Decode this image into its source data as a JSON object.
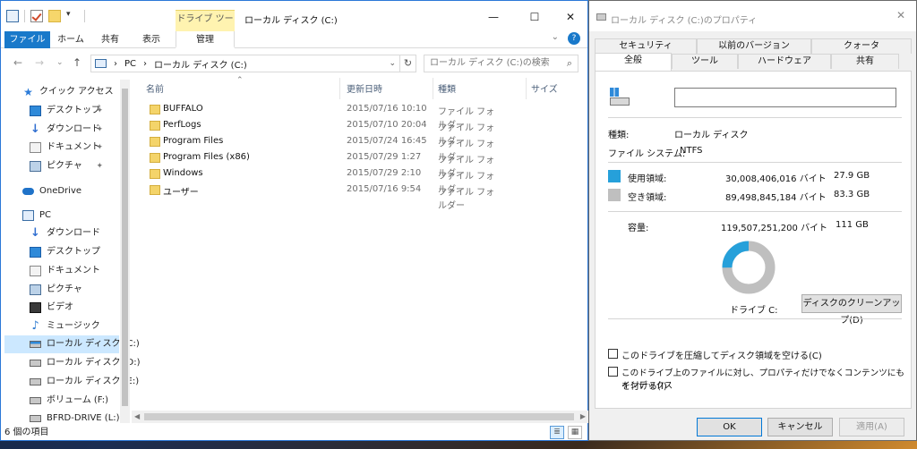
{
  "explorer": {
    "title": "ローカル ディスク (C:)",
    "contextual_tab_group": "ドライブ ツール",
    "ribbon_tabs": [
      "ファイル",
      "ホーム",
      "共有",
      "表示",
      "管理"
    ],
    "window_buttons": {
      "minimize": "—",
      "maximize": "☐",
      "close": "✕"
    },
    "address": {
      "segments": [
        "PC",
        "ローカル ディスク (C:)"
      ],
      "separator": "›"
    },
    "search_placeholder": "ローカル ディスク (C:)の検索",
    "columns": [
      "名前",
      "更新日時",
      "種類",
      "サイズ"
    ],
    "files": [
      {
        "name": "BUFFALO",
        "date": "2015/07/16 10:10",
        "type": "ファイル フォルダー"
      },
      {
        "name": "PerfLogs",
        "date": "2015/07/10 20:04",
        "type": "ファイル フォルダー"
      },
      {
        "name": "Program Files",
        "date": "2015/07/24 16:45",
        "type": "ファイル フォルダー"
      },
      {
        "name": "Program Files (x86)",
        "date": "2015/07/29 1:27",
        "type": "ファイル フォルダー"
      },
      {
        "name": "Windows",
        "date": "2015/07/29 2:10",
        "type": "ファイル フォルダー"
      },
      {
        "name": "ユーザー",
        "date": "2015/07/16 9:54",
        "type": "ファイル フォルダー"
      }
    ],
    "nav": {
      "quick_access": "クイック アクセス",
      "quick_items": [
        "デスクトップ",
        "ダウンロード",
        "ドキュメント",
        "ピクチャ"
      ],
      "onedrive": "OneDrive",
      "pc": "PC",
      "pc_items": [
        "ダウンロード",
        "デスクトップ",
        "ドキュメント",
        "ピクチャ",
        "ビデオ",
        "ミュージック",
        "ローカル ディスク (C:)",
        "ローカル ディスク (D:)",
        "ローカル ディスク (E:)",
        "ボリューム (F:)",
        "BFRD-DRIVE (L:)"
      ],
      "selected": "ローカル ディスク (C:)"
    },
    "status": "6 個の項目"
  },
  "props": {
    "title": "ローカル ディスク (C:)のプロパティ",
    "close": "✕",
    "tabs_row1": [
      "セキュリティ",
      "以前のバージョン",
      "クォータ"
    ],
    "tabs_row2": [
      "全般",
      "ツール",
      "ハードウェア",
      "共有"
    ],
    "active_tab": "全般",
    "volume_name_value": "",
    "type_label": "種類:",
    "type_value": "ローカル ディスク",
    "fs_label": "ファイル システム:",
    "fs_value": "NTFS",
    "used_label": "使用領域:",
    "used_bytes": "30,008,406,016 バイト",
    "used_size": "27.9 GB",
    "free_label": "空き領域:",
    "free_bytes": "89,498,845,184 バイト",
    "free_size": "83.3 GB",
    "capacity_label": "容量:",
    "capacity_bytes": "119,507,251,200 バイト",
    "capacity_size": "111 GB",
    "drive_label": "ドライブ C:",
    "cleanup_button": "ディスクのクリーンアップ(D)",
    "compress_label": "このドライブを圧縮してディスク領域を空ける(C)",
    "index_label_line1": "このドライブ上のファイルに対し、プロパティだけでなくコンテンツにもインデックス",
    "index_label_line2": "を付ける(I)",
    "ok": "OK",
    "cancel": "キャンセル",
    "apply": "適用(A)",
    "usage_fraction": {
      "used": 0.251,
      "free": 0.749
    },
    "colors": {
      "used": "#26a0da",
      "free": "#bfbfbf"
    }
  }
}
